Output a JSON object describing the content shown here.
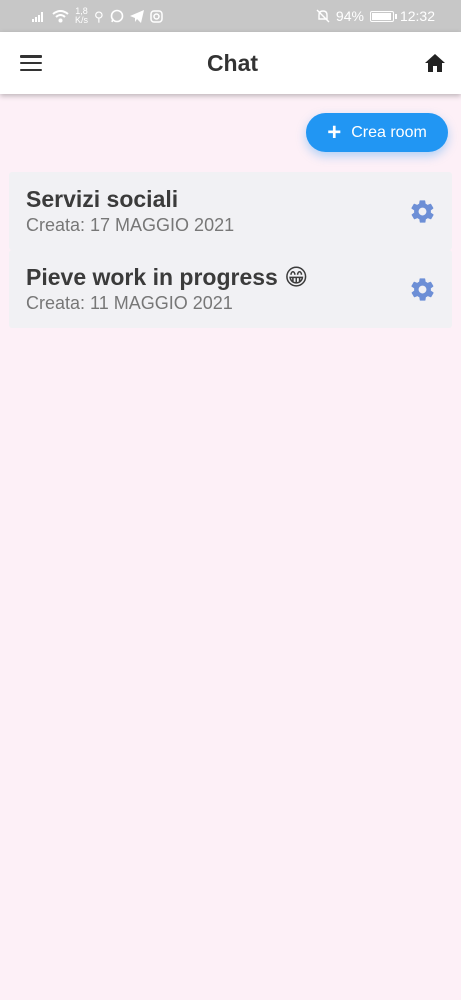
{
  "status_bar": {
    "speed_value": "1,8",
    "speed_unit": "K/s",
    "battery": "94%",
    "time": "12:32"
  },
  "app_bar": {
    "title": "Chat",
    "left_icon": "menu-icon",
    "right_icon": "home-icon"
  },
  "fab": {
    "icon": "plus-icon",
    "label": "Crea room"
  },
  "rooms": [
    {
      "name": "Servizi sociali",
      "created": "Creata: 17 MAGGIO 2021"
    },
    {
      "name": "Pieve work in progress 😁",
      "created": "Creata: 11 MAGGIO 2021"
    }
  ],
  "colors": {
    "accent": "#2196f3",
    "gear": "#6d8fd6",
    "background": "#fdf0f7",
    "card": "#f1f1f4"
  }
}
